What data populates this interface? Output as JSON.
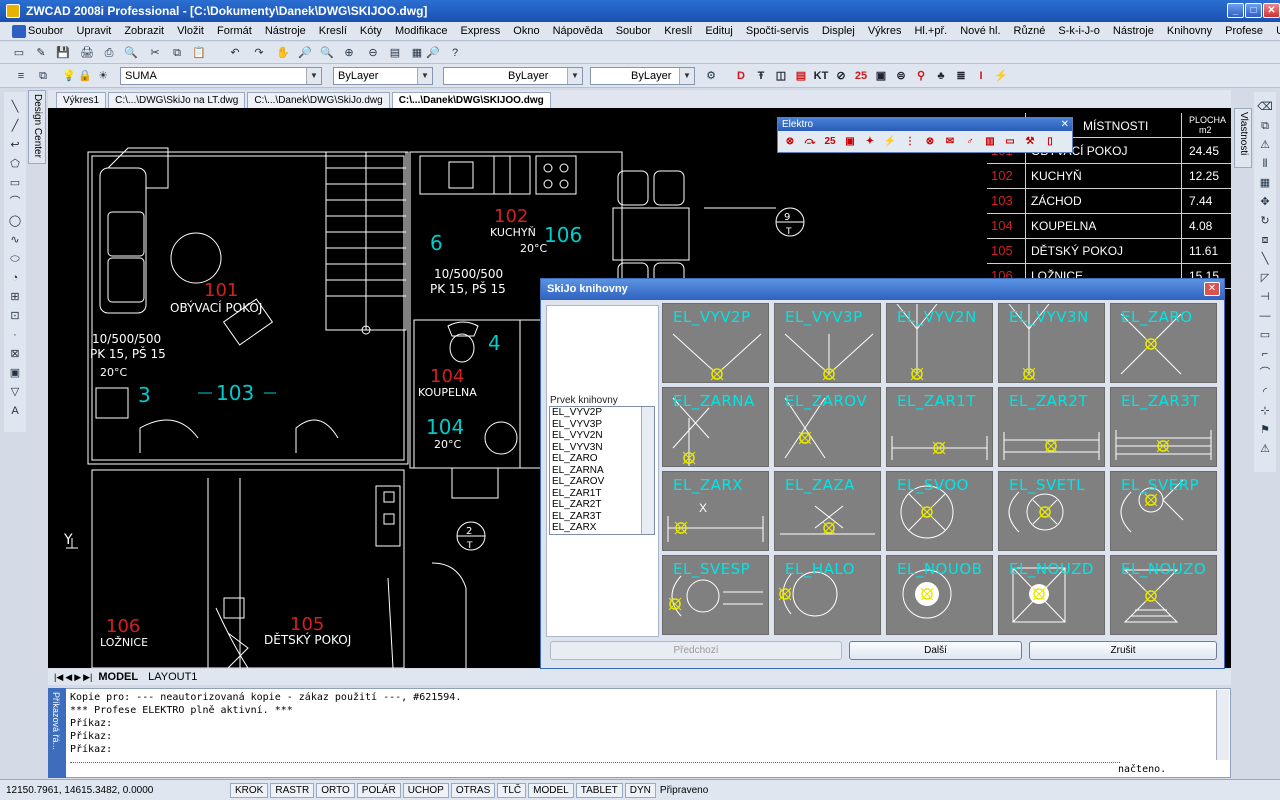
{
  "title": "ZWCAD 2008i Professional - [C:\\Dokumenty\\Danek\\DWG\\SKIJOO.dwg]",
  "menu": [
    "Soubor",
    "Upravit",
    "Zobrazit",
    "Vložit",
    "Formát",
    "Nástroje",
    "Kreslí",
    "Kóty",
    "Modifikace",
    "Express",
    "Okno",
    "Nápověda",
    "Soubor",
    "Kreslí",
    "Edituj",
    "Spočti-servis",
    "Displej",
    "Výkres",
    "Hl.+př.",
    "Nové hl.",
    "Různé",
    "S-k-i-J-o",
    "Nástroje",
    "Knihovny",
    "Profese",
    "Uchopení"
  ],
  "layer": {
    "value": "SUMA",
    "color": "ByLayer",
    "linetype": "ByLayer",
    "lineweight": "ByLayer"
  },
  "doc_tabs": [
    "Výkres1",
    "C:\\...\\DWG\\SkiJo na LT.dwg",
    "C:\\...\\Danek\\DWG\\SkiJo.dwg",
    "C:\\...\\Danek\\DWG\\SKIJOO.dwg"
  ],
  "design_center": "Design Center",
  "properties": "Vlastnosti",
  "elektro": {
    "title": "Elektro"
  },
  "table": {
    "header1": "MÍSTNOSTI",
    "header2a": "PLOCHA",
    "header2b": "m2",
    "rows": [
      {
        "num": "101",
        "name": "OBÝVACÍ POKOJ",
        "area": "24.45"
      },
      {
        "num": "102",
        "name": "KUCHYŇ",
        "area": "12.25"
      },
      {
        "num": "103",
        "name": "ZÁCHOD",
        "area": "7.44"
      },
      {
        "num": "104",
        "name": "KOUPELNA",
        "area": "4.08"
      },
      {
        "num": "105",
        "name": "DĚTSKÝ POKOJ",
        "area": "11.61"
      },
      {
        "num": "106",
        "name": "LOŽNICE",
        "area": "15.15"
      }
    ]
  },
  "plan": {
    "r101": "101",
    "r101name": "OBÝVACÍ POKOJ",
    "r101info1": "10/500/500",
    "r101info2": "PK 15, PŠ 15",
    "r101temp": "20°C",
    "r102": "102",
    "r102name": "KUCHYŇ",
    "r102temp": "20°C",
    "r102info1": "10/500/500",
    "r102info2": "PK 15, PŠ 15",
    "n106": "106",
    "n6": "6",
    "n3": "3",
    "n103": "103",
    "n104": "104",
    "n4": "4",
    "r104": "104",
    "r104name": "KOUPELNA",
    "r104temp": "20°C",
    "r106": "106",
    "r106name": "LOŽNICE",
    "r105": "105",
    "r105name": "DĚTSKÝ POKOJ",
    "stair9": "9",
    "stairT": "T",
    "stair2": "2",
    "stairT2": "T",
    "y": "Y"
  },
  "dialog": {
    "title": "SkiJo knihovny",
    "list_label": "Prvek knihovny",
    "list": [
      "EL_VYV2P",
      "EL_VYV3P",
      "EL_VYV2N",
      "EL_VYV3N",
      "EL_ZARO",
      "EL_ZARNA",
      "EL_ZAROV",
      "EL_ZAR1T",
      "EL_ZAR2T",
      "EL_ZAR3T",
      "EL_ZARX"
    ],
    "cells": [
      "EL_VYV2P",
      "EL_VYV3P",
      "EL_VYV2N",
      "EL_VYV3N",
      "EL_ZARO",
      "EL_ZARNA",
      "EL_ZAROV",
      "EL_ZAR1T",
      "EL_ZAR2T",
      "EL_ZAR3T",
      "EL_ZARX",
      "EL_ZAZA",
      "EL_SVOO",
      "EL_SVETL",
      "EL_SVERP",
      "EL_SVESP",
      "EL_HALO",
      "EL_NOUOB",
      "EL_NOUZD",
      "EL_NOUZO"
    ],
    "btn_prev": "Předchozí",
    "btn_next": "Další",
    "btn_cancel": "Zrušit"
  },
  "layout_tabs": [
    "MODEL",
    "LAYOUT1"
  ],
  "command": {
    "side_label": "Příkazová řá...",
    "lines": [
      "Kopie pro: --- neautorizovaná kopie - zákaz použití ---, #621594.",
      "*** Profese ELEKTRO plně aktivní. ***",
      "Příkaz:",
      "Příkaz:",
      "Příkaz:"
    ],
    "status_right": "načteno."
  },
  "status": {
    "coords": "12150.7961, 14615.3482, 0.0000",
    "toggles": [
      "KROK",
      "RASTR",
      "ORTO",
      "POLÁR",
      "UCHOP",
      "OTRAS",
      "TLČ",
      "MODEL",
      "TABLET",
      "DYN"
    ],
    "ready": "Připraveno"
  },
  "colors": {
    "accent_red": "#d01818",
    "cyan": "#00e5e5",
    "yellow": "#e8e800"
  }
}
